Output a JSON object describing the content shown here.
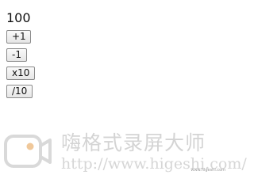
{
  "counter": {
    "value": "100"
  },
  "buttons": [
    {
      "label": "+1"
    },
    {
      "label": "-1"
    },
    {
      "label": "x10"
    },
    {
      "label": "/10"
    }
  ],
  "watermark": {
    "title": "嗨格式录屏大师",
    "url": "http://www.higeshi.com/",
    "small_text": "www.higeshi.com",
    "logo": "camera-logo-icon",
    "color": "#d4d4d4",
    "accent": "#f0c89a"
  }
}
